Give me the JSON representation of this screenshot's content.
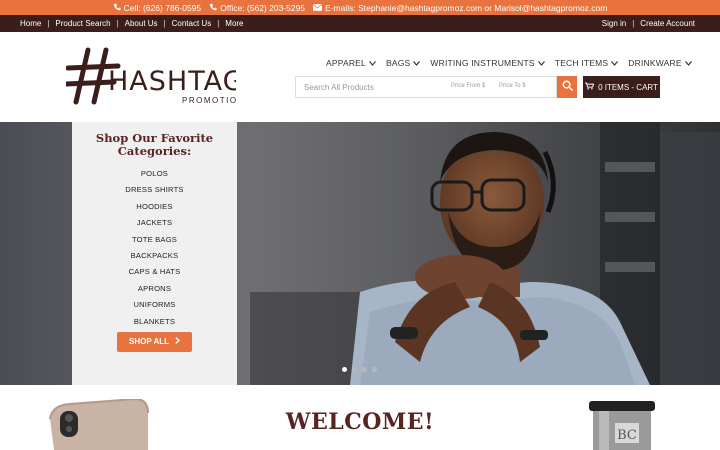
{
  "topbar": {
    "cell": "Cell: (626) 786-0595",
    "office": "Office: (562) 203-5295",
    "emails": "E-mails: Stephanie@hashtagpromoz.com or Marisol@hashtagpromoz.com"
  },
  "nav": {
    "left": [
      "Home",
      "Product Search",
      "About Us",
      "Contact Us",
      "More"
    ],
    "signin": "Sign in",
    "create": "Create Account"
  },
  "logo": {
    "text": "HASHTAG",
    "sub": "PROMOTIONS"
  },
  "menu": [
    "APPAREL",
    "BAGS",
    "WRITING INSTRUMENTS",
    "TECH ITEMS",
    "DRINKWARE"
  ],
  "search": {
    "placeholder": "Search All Products",
    "price_from": "Price From $",
    "price_to": "Price To $"
  },
  "cart": {
    "label": "0 ITEMS - CART"
  },
  "categories": {
    "title": "Shop Our Favorite Categories:",
    "items": [
      "POLOS",
      "DRESS SHIRTS",
      "HOODIES",
      "JACKETS",
      "TOTE BAGS",
      "BACKPACKS",
      "CAPS & HATS",
      "APRONS",
      "UNIFORMS",
      "BLANKETS"
    ],
    "shop_all": "SHOP ALL"
  },
  "carousel": {
    "slides": 4,
    "active": 1
  },
  "welcome": {
    "title": "WELCOME!",
    "tumbler_text": "BC"
  },
  "colors": {
    "orange": "#e8733e",
    "brown": "#3b1d1c",
    "maroon": "#5a2322"
  }
}
